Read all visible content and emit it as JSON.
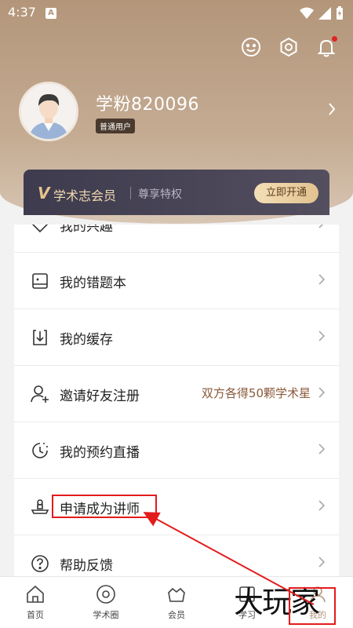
{
  "status_bar": {
    "time": "4:37",
    "notification_icon": "A"
  },
  "header": {
    "icons": [
      "face-icon",
      "settings-icon",
      "bell-icon"
    ]
  },
  "profile": {
    "username": "学粉820096",
    "user_type": "普通用户"
  },
  "vip_card": {
    "logo_letter": "V",
    "title": "学术志会员",
    "subtitle": "尊享特权",
    "button_label": "立即开通"
  },
  "menu": {
    "items": [
      {
        "label": "我的兴趣",
        "extra": "",
        "icon": "heart-icon"
      },
      {
        "label": "我的错题本",
        "extra": "",
        "icon": "notebook-icon"
      },
      {
        "label": "我的缓存",
        "extra": "",
        "icon": "download-icon"
      },
      {
        "label": "邀请好友注册",
        "extra": "双方各得50颗学术星",
        "icon": "add-user-icon"
      },
      {
        "label": "我的预约直播",
        "extra": "",
        "icon": "clock-icon"
      },
      {
        "label": "申请成为讲师",
        "extra": "",
        "icon": "lecturer-icon"
      },
      {
        "label": "帮助反馈",
        "extra": "",
        "icon": "help-icon"
      }
    ]
  },
  "tabbar": {
    "tabs": [
      {
        "label": "首页",
        "icon": "home-icon"
      },
      {
        "label": "学术圈",
        "icon": "circle-icon"
      },
      {
        "label": "会员",
        "icon": "crown-icon"
      },
      {
        "label": "学习",
        "icon": "study-icon"
      },
      {
        "label": "我的",
        "icon": "profile-icon"
      }
    ]
  },
  "watermark": "大玩家",
  "colors": {
    "accent": "#b3967a",
    "highlight": "#e31b1b",
    "vip_bg": "#3e3b4e"
  }
}
